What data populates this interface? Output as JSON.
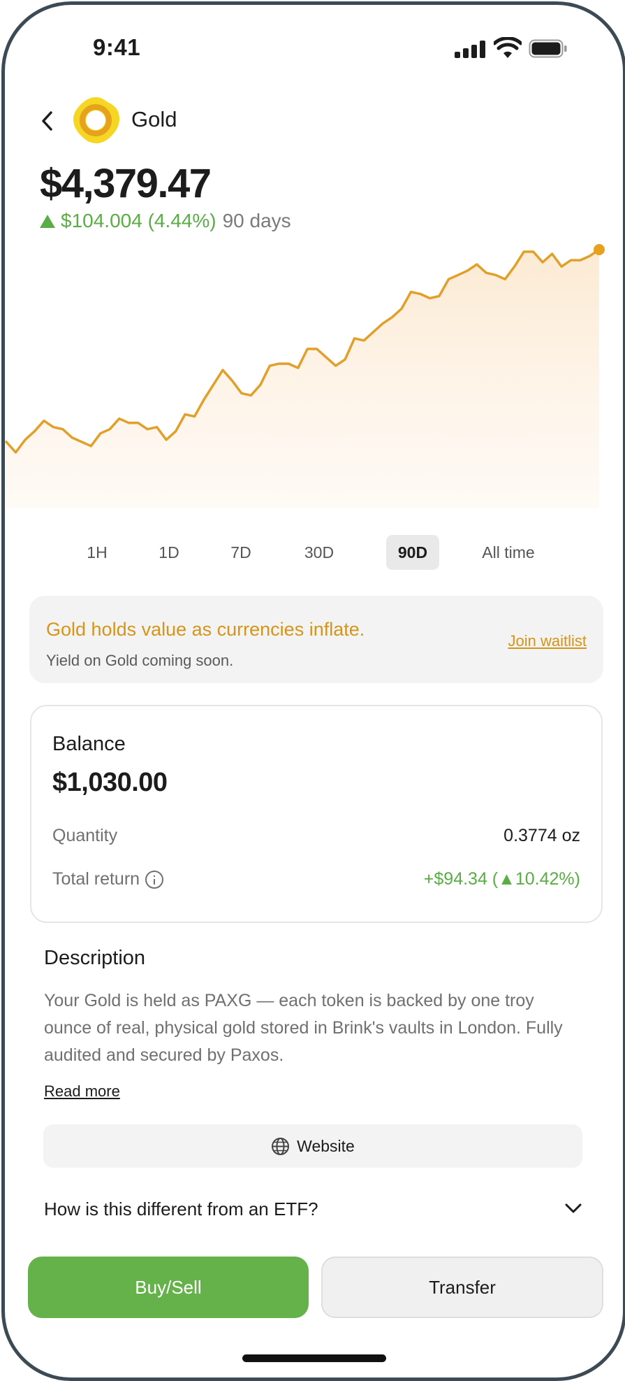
{
  "status_bar": {
    "time": "9:41"
  },
  "header": {
    "asset_name": "Gold"
  },
  "price": {
    "current": "$4,379.47",
    "change": "$104.004 (4.44%)",
    "period": "90 days"
  },
  "chart_data": {
    "type": "line",
    "color": "#e0a02a",
    "values": [
      4275,
      4270,
      4276,
      4280,
      4285,
      4282,
      4281,
      4277,
      4275,
      4273,
      4279,
      4281,
      4286,
      4284,
      4284,
      4281,
      4282,
      4276,
      4280,
      4288,
      4287,
      4295,
      4302,
      4309,
      4304,
      4298,
      4297,
      4302,
      4311,
      4312,
      4312,
      4310,
      4319,
      4319,
      4315,
      4311,
      4314,
      4324,
      4323,
      4327,
      4331,
      4334,
      4338,
      4346,
      4345,
      4343,
      4344,
      4352,
      4354,
      4356,
      4359,
      4355,
      4354,
      4352,
      4358,
      4365,
      4365,
      4360,
      4364,
      4358,
      4361,
      4361,
      4363,
      4366
    ]
  },
  "range_tabs": [
    "1H",
    "1D",
    "7D",
    "30D",
    "90D",
    "All time"
  ],
  "active_range": "90D",
  "promo": {
    "title": "Gold holds value as currencies inflate.",
    "subtitle": "Yield on Gold coming soon.",
    "link": "Join waitlist"
  },
  "balance": {
    "label": "Balance",
    "value": "$1,030.00",
    "quantity_label": "Quantity",
    "quantity_value": "0.3774 oz",
    "return_label": "Total return",
    "return_value": "+$94.34  (▲10.42%)"
  },
  "description": {
    "title": "Description",
    "body": "Your Gold is held as PAXG — each token is backed by one troy ounce of real, physical gold stored in Brink's vaults in London. Fully audited and secured by Paxos.",
    "read_more": "Read more"
  },
  "website": {
    "label": "Website"
  },
  "faq": {
    "question": "How is this different from an ETF?"
  },
  "actions": {
    "buy_sell": "Buy/Sell",
    "transfer": "Transfer"
  },
  "colors": {
    "accent_gold": "#d49519",
    "positive_green": "#5aad45",
    "button_green": "#65b14a"
  }
}
